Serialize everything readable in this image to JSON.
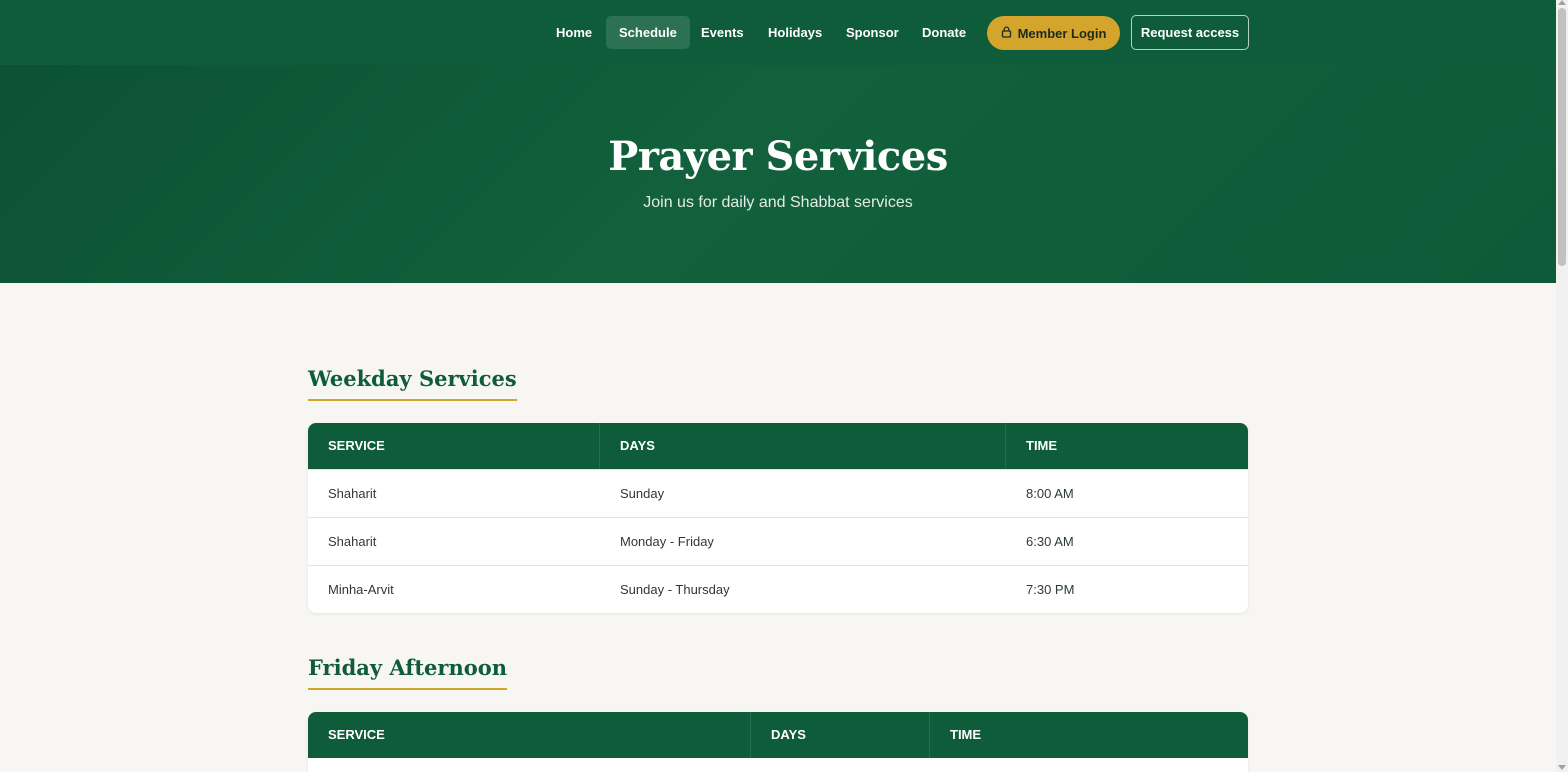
{
  "nav": {
    "items": [
      {
        "label": "Home",
        "active": false
      },
      {
        "label": "Schedule",
        "active": true
      },
      {
        "label": "Events",
        "active": false
      },
      {
        "label": "Holidays",
        "active": false
      },
      {
        "label": "Sponsor",
        "active": false
      },
      {
        "label": "Donate",
        "active": false
      }
    ],
    "login_label": "Member Login",
    "login_icon": "lock-icon",
    "request_label": "Request access"
  },
  "hero": {
    "title": "Prayer Services",
    "subtitle": "Join us for daily and Shabbat services"
  },
  "weekday": {
    "title": "Weekday Services",
    "headers": [
      "SERVICE",
      "DAYS",
      "TIME"
    ],
    "rows": [
      [
        "Shaharit",
        "Sunday",
        "8:00 AM"
      ],
      [
        "Shaharit",
        "Monday - Friday",
        "6:30 AM"
      ],
      [
        "Minha-Arvit",
        "Sunday - Thursday",
        "7:30 PM"
      ]
    ]
  },
  "friday": {
    "title": "Friday Afternoon",
    "headers": [
      "SERVICE",
      "DAYS",
      "TIME"
    ]
  },
  "colors": {
    "brand_green": "#0e5c3a",
    "accent_gold": "#d4a52c",
    "page_bg": "#f8f6f2"
  }
}
